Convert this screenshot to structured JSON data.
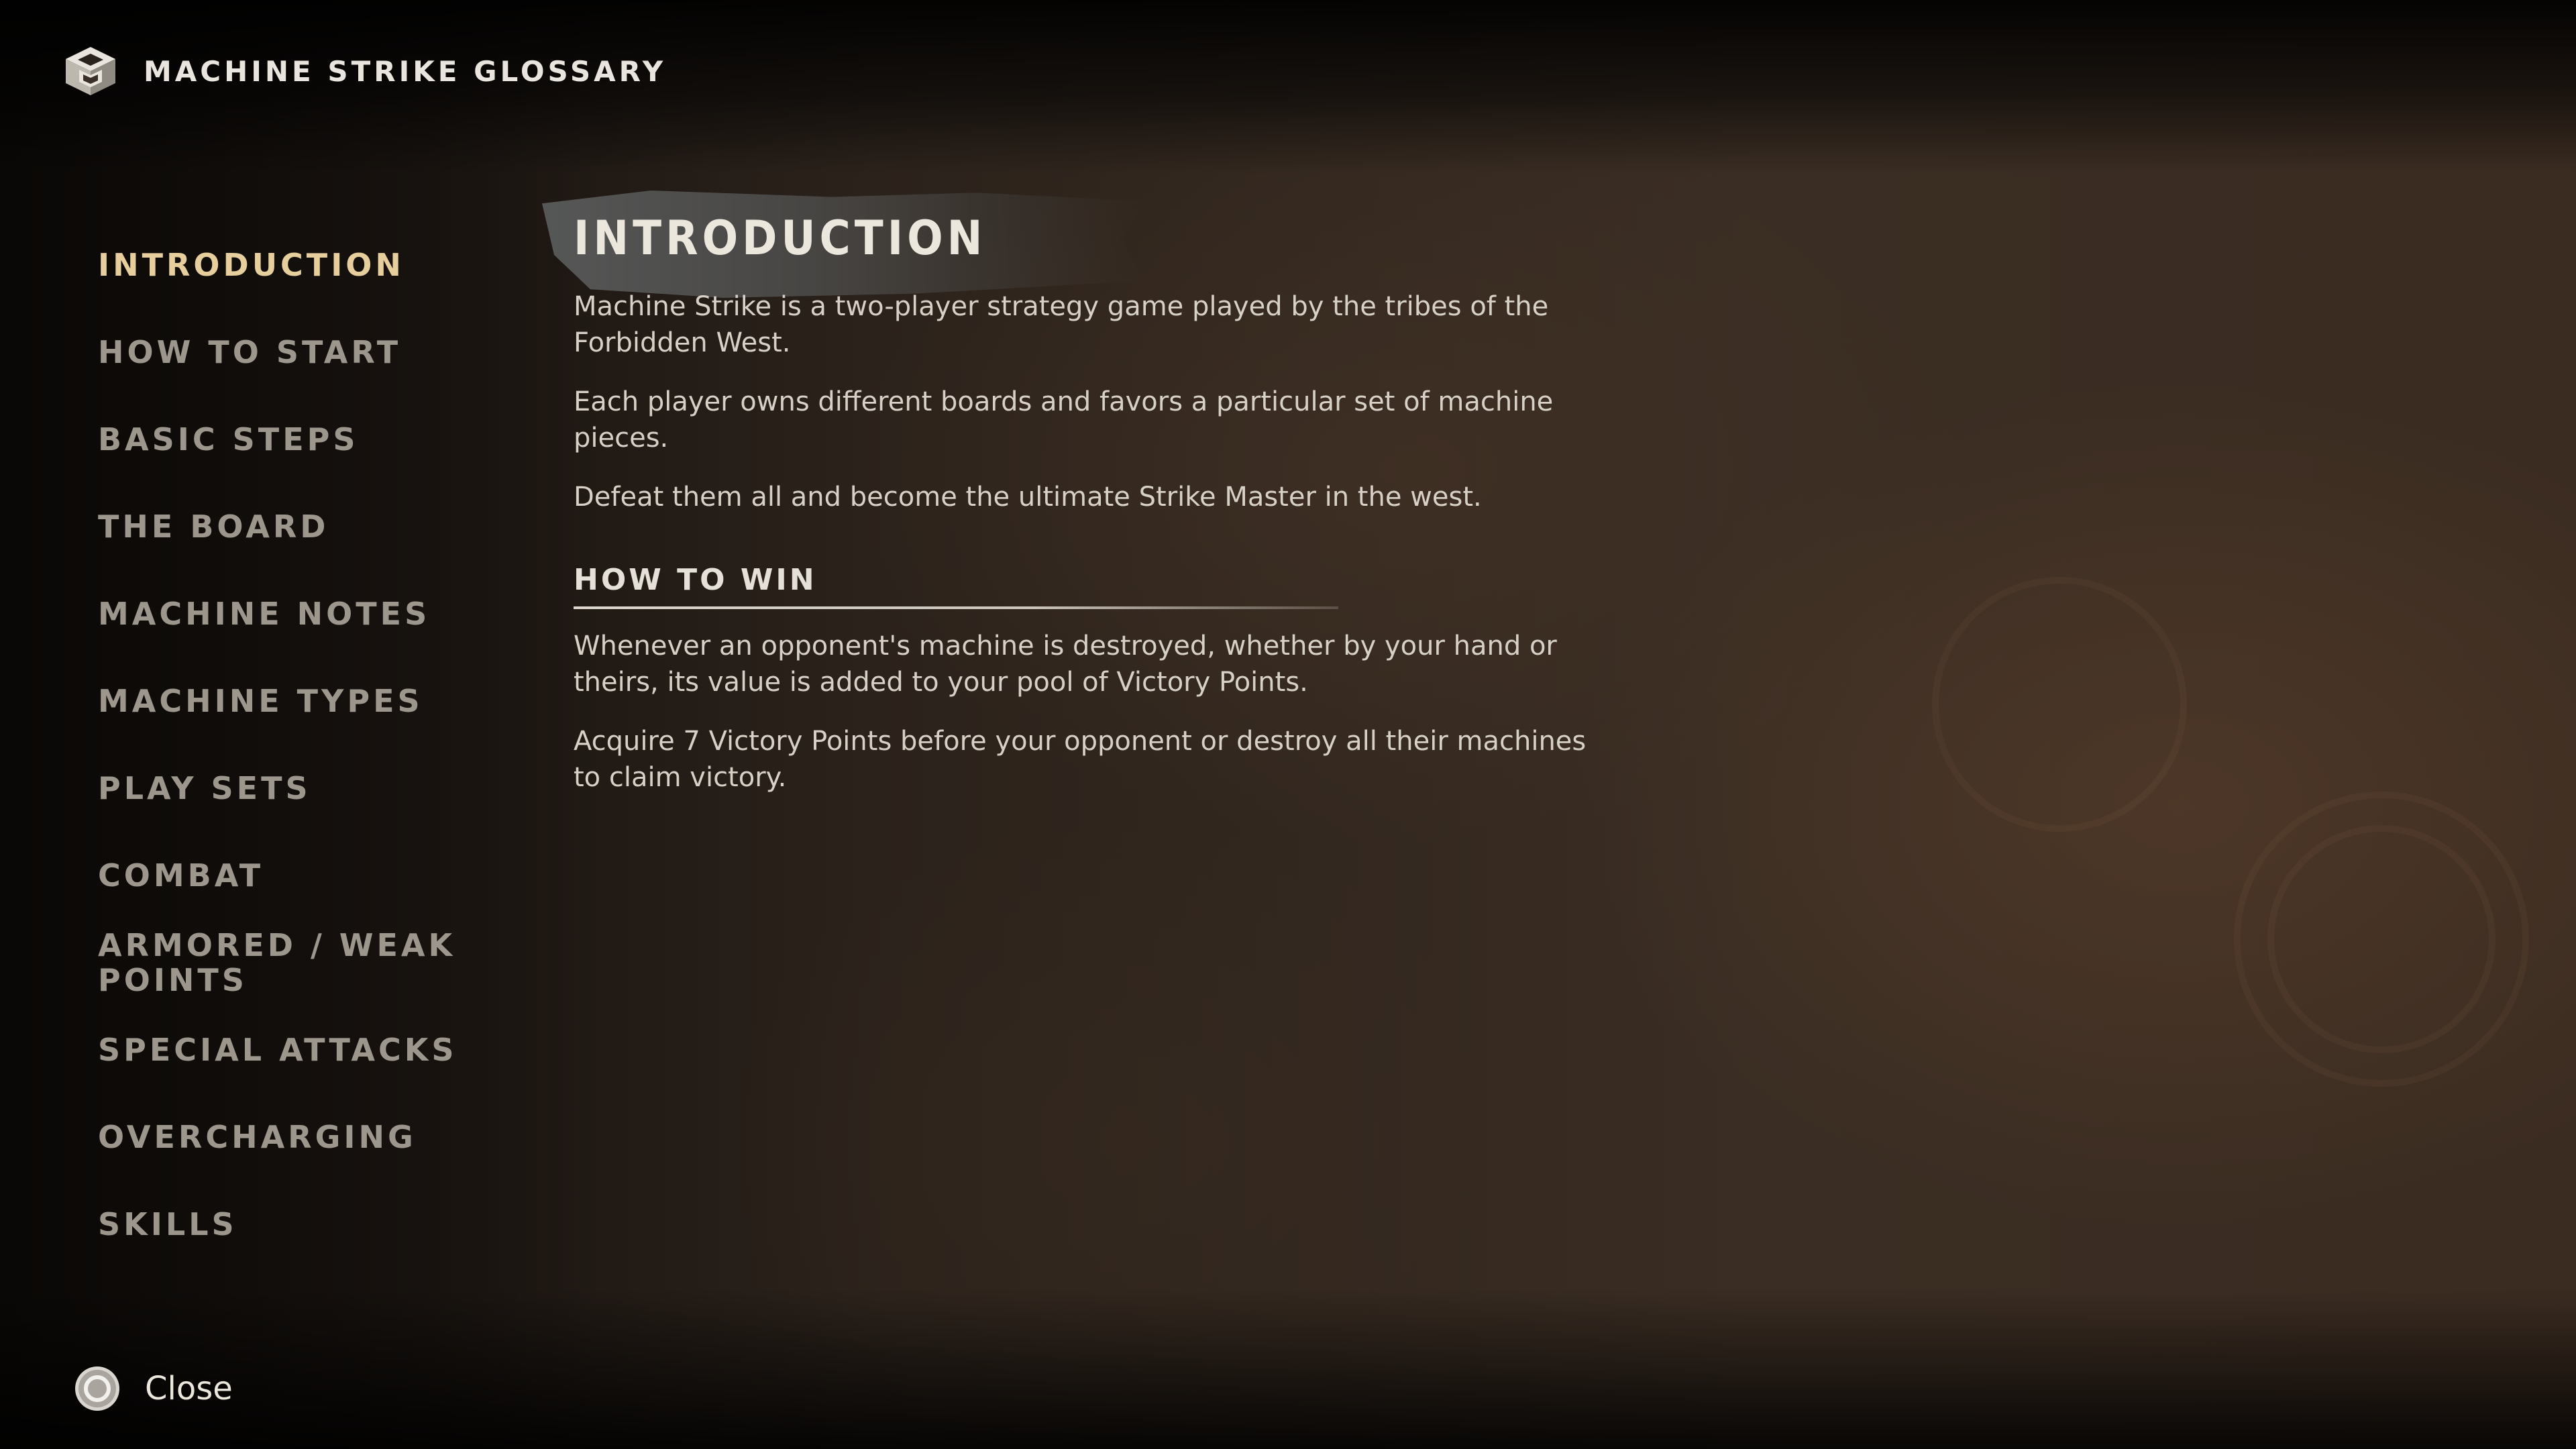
{
  "header": {
    "title": "MACHINE STRIKE GLOSSARY",
    "icon": "machine-strike-piece-icon"
  },
  "sidebar": {
    "items": [
      {
        "label": "INTRODUCTION",
        "active": true
      },
      {
        "label": "HOW TO START",
        "active": false
      },
      {
        "label": "BASIC STEPS",
        "active": false
      },
      {
        "label": "THE BOARD",
        "active": false
      },
      {
        "label": "MACHINE NOTES",
        "active": false
      },
      {
        "label": "MACHINE TYPES",
        "active": false
      },
      {
        "label": "PLAY SETS",
        "active": false
      },
      {
        "label": "COMBAT",
        "active": false
      },
      {
        "label": "ARMORED / WEAK POINTS",
        "active": false
      },
      {
        "label": "SPECIAL ATTACKS",
        "active": false
      },
      {
        "label": "OVERCHARGING",
        "active": false
      },
      {
        "label": "SKILLS",
        "active": false
      }
    ],
    "active_color": "#e6cf9c",
    "inactive_color": "#9c968c"
  },
  "content": {
    "title": "INTRODUCTION",
    "intro_paragraphs": [
      "Machine Strike is a two-player strategy game played by the tribes of the Forbidden West.",
      "Each player owns different boards and favors a particular set of machine pieces.",
      "Defeat them all and become the ultimate Strike Master in the west."
    ],
    "section": {
      "heading": "HOW TO WIN",
      "paragraphs": [
        "Whenever an opponent's machine is destroyed, whether by your hand or theirs, its value is added to your pool of Victory Points.",
        "Acquire 7 Victory Points before your opponent or destroy all their machines to claim victory."
      ]
    }
  },
  "footer": {
    "close_label": "Close",
    "button_icon": "circle-button-icon"
  }
}
